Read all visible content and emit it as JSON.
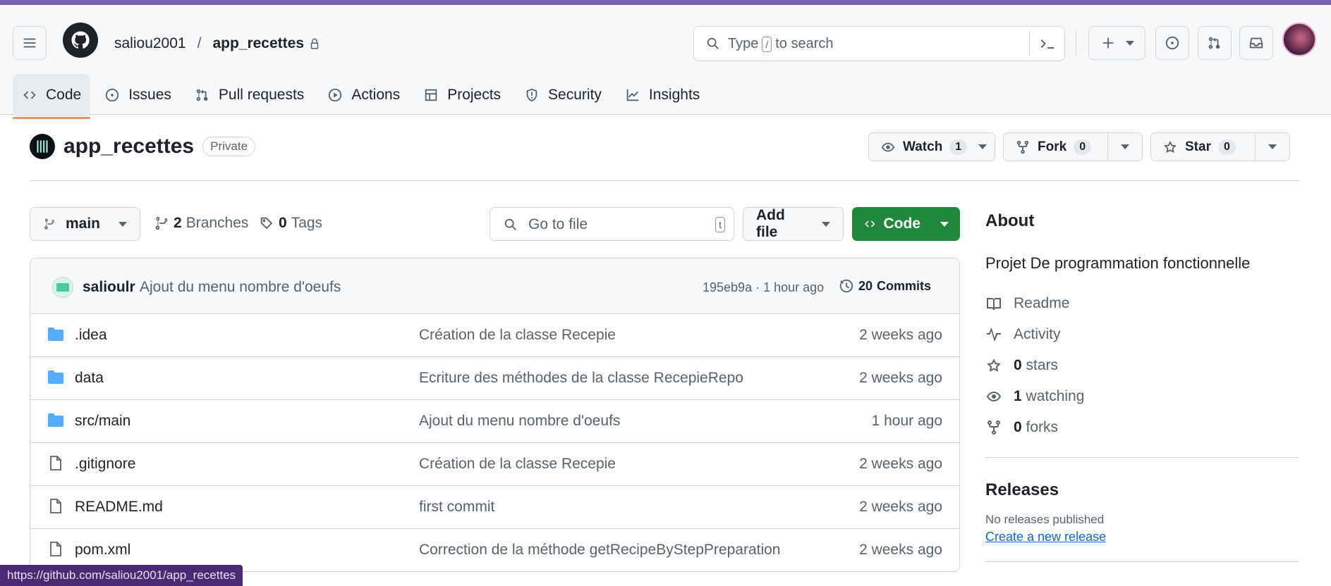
{
  "header": {
    "owner": "saliou2001",
    "separator": "/",
    "repo": "app_recettes",
    "search_prefix": "Type",
    "search_key": "/",
    "search_suffix": "to search"
  },
  "tabs": [
    {
      "label": "Code",
      "icon": "code-icon"
    },
    {
      "label": "Issues",
      "icon": "issue-icon"
    },
    {
      "label": "Pull requests",
      "icon": "pull-request-icon"
    },
    {
      "label": "Actions",
      "icon": "play-icon"
    },
    {
      "label": "Projects",
      "icon": "table-icon"
    },
    {
      "label": "Security",
      "icon": "shield-icon"
    },
    {
      "label": "Insights",
      "icon": "graph-icon"
    }
  ],
  "repo": {
    "title": "app_recettes",
    "visibility": "Private",
    "watch_label": "Watch",
    "watch_count": "1",
    "fork_label": "Fork",
    "fork_count": "0",
    "star_label": "Star",
    "star_count": "0"
  },
  "toolbar": {
    "branch": "main",
    "branches_count": "2",
    "branches_label": "Branches",
    "tags_count": "0",
    "tags_label": "Tags",
    "goto_placeholder": "Go to file",
    "goto_key": "t",
    "add_file_label": "Add file",
    "code_label": "Code"
  },
  "latest_commit": {
    "author": "salioulr",
    "message": "Ajout du menu nombre d'oeufs",
    "sha_time": "195eb9a · 1 hour ago",
    "commits_count": "20",
    "commits_label": "Commits"
  },
  "files": [
    {
      "name": ".idea",
      "type": "folder",
      "message": "Création de la classe Recepie",
      "when": "2 weeks ago"
    },
    {
      "name": "data",
      "type": "folder",
      "message": "Ecriture des méthodes de la classe RecepieRepo",
      "when": "2 weeks ago"
    },
    {
      "name": "src/main",
      "type": "folder",
      "message": "Ajout du menu nombre d'oeufs",
      "when": "1 hour ago"
    },
    {
      "name": ".gitignore",
      "type": "file",
      "message": "Création de la classe Recepie",
      "when": "2 weeks ago"
    },
    {
      "name": "README.md",
      "type": "file",
      "message": "first commit",
      "when": "2 weeks ago"
    },
    {
      "name": "pom.xml",
      "type": "file",
      "message": "Correction de la méthode getRecipeByStepPreparation",
      "when": "2 weeks ago"
    }
  ],
  "about": {
    "heading": "About",
    "description": "Projet De programmation fonctionnelle",
    "readme": "Readme",
    "activity": "Activity",
    "stars_count": "0",
    "stars_label": "stars",
    "watching_count": "1",
    "watching_label": "watching",
    "forks_count": "0",
    "forks_label": "forks",
    "releases_heading": "Releases",
    "no_releases": "No releases published",
    "create_release": "Create a new release"
  },
  "statusbar": {
    "url": "https://github.com/saliou2001/app_recettes"
  },
  "colors": {
    "accent": "#1f883d",
    "active_tab_underline": "#fd8c73",
    "folder": "#54aeff",
    "link": "#0969da"
  }
}
